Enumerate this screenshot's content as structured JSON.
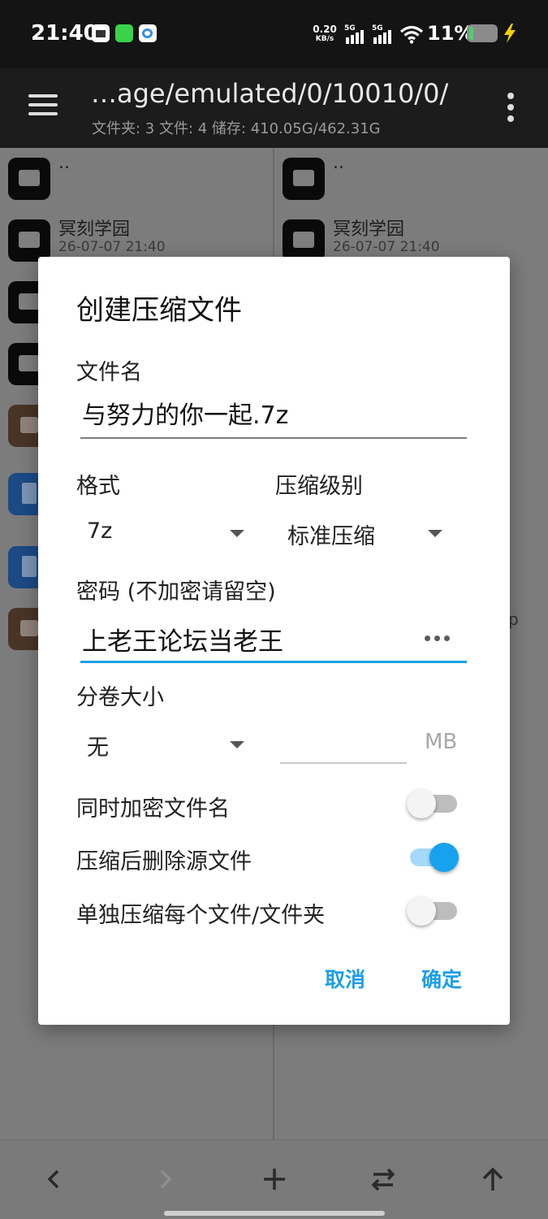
{
  "status_bar": {
    "time": "21:40",
    "net_speed_value": "0.20",
    "net_speed_unit": "KB/s",
    "sim1_tag": "5G",
    "sim2_tag": "5G",
    "battery_percent": "11%",
    "app_icons": [
      "doc-app-icon",
      "kook-app-icon",
      "cloud-app-icon"
    ],
    "battery_color": "#49d26a",
    "charging_bolt_color": "#f5d000"
  },
  "toolbar": {
    "path": "…age/emulated/0/10010/0/",
    "summary": "文件夹: 3  文件: 4  储存: 410.05G/462.31G"
  },
  "left_pane": {
    "items": [
      {
        "icon": "folder-icon",
        "name": "..",
        "date": ""
      },
      {
        "icon": "folder-icon",
        "name": "冥刻学园",
        "date": "26-07-07 21:40"
      },
      {
        "icon": "folder-icon",
        "name": "",
        "date": ""
      },
      {
        "icon": "folder-icon",
        "name": "",
        "date": ""
      },
      {
        "icon": "archive-icon",
        "name": "",
        "date": ""
      },
      {
        "icon": "document-icon",
        "name": "",
        "date": ""
      },
      {
        "icon": "document-icon",
        "name": "",
        "date": ""
      },
      {
        "icon": "archive-icon",
        "name": "",
        "date": ""
      }
    ]
  },
  "right_pane": {
    "items": [
      {
        "icon": "folder-icon",
        "name": "..",
        "date": ""
      },
      {
        "icon": "folder-icon",
        "name": "冥刻学园",
        "date": "26-07-07 21:40"
      }
    ],
    "stray_text": "p"
  },
  "dialog": {
    "title": "创建压缩文件",
    "filename_label": "文件名",
    "filename_value": "与努力的你一起.7z",
    "format_label": "格式",
    "format_value": "7z",
    "level_label": "压缩级别",
    "level_value": "标准压缩",
    "password_label": "密码 (不加密请留空)",
    "password_value": "上老王论坛当老王",
    "split_label": "分卷大小",
    "split_value": "无",
    "split_size_value": "",
    "split_unit": "MB",
    "toggles": [
      {
        "label": "同时加密文件名",
        "on": false
      },
      {
        "label": "压缩后删除源文件",
        "on": true
      },
      {
        "label": "单独压缩每个文件/文件夹",
        "on": false
      }
    ],
    "cancel_label": "取消",
    "confirm_label": "确定",
    "accent_color": "#1ea0e6"
  },
  "bottom_bar": {
    "buttons": [
      "back-icon",
      "forward-icon",
      "add-icon",
      "swap-icon",
      "up-icon"
    ]
  }
}
